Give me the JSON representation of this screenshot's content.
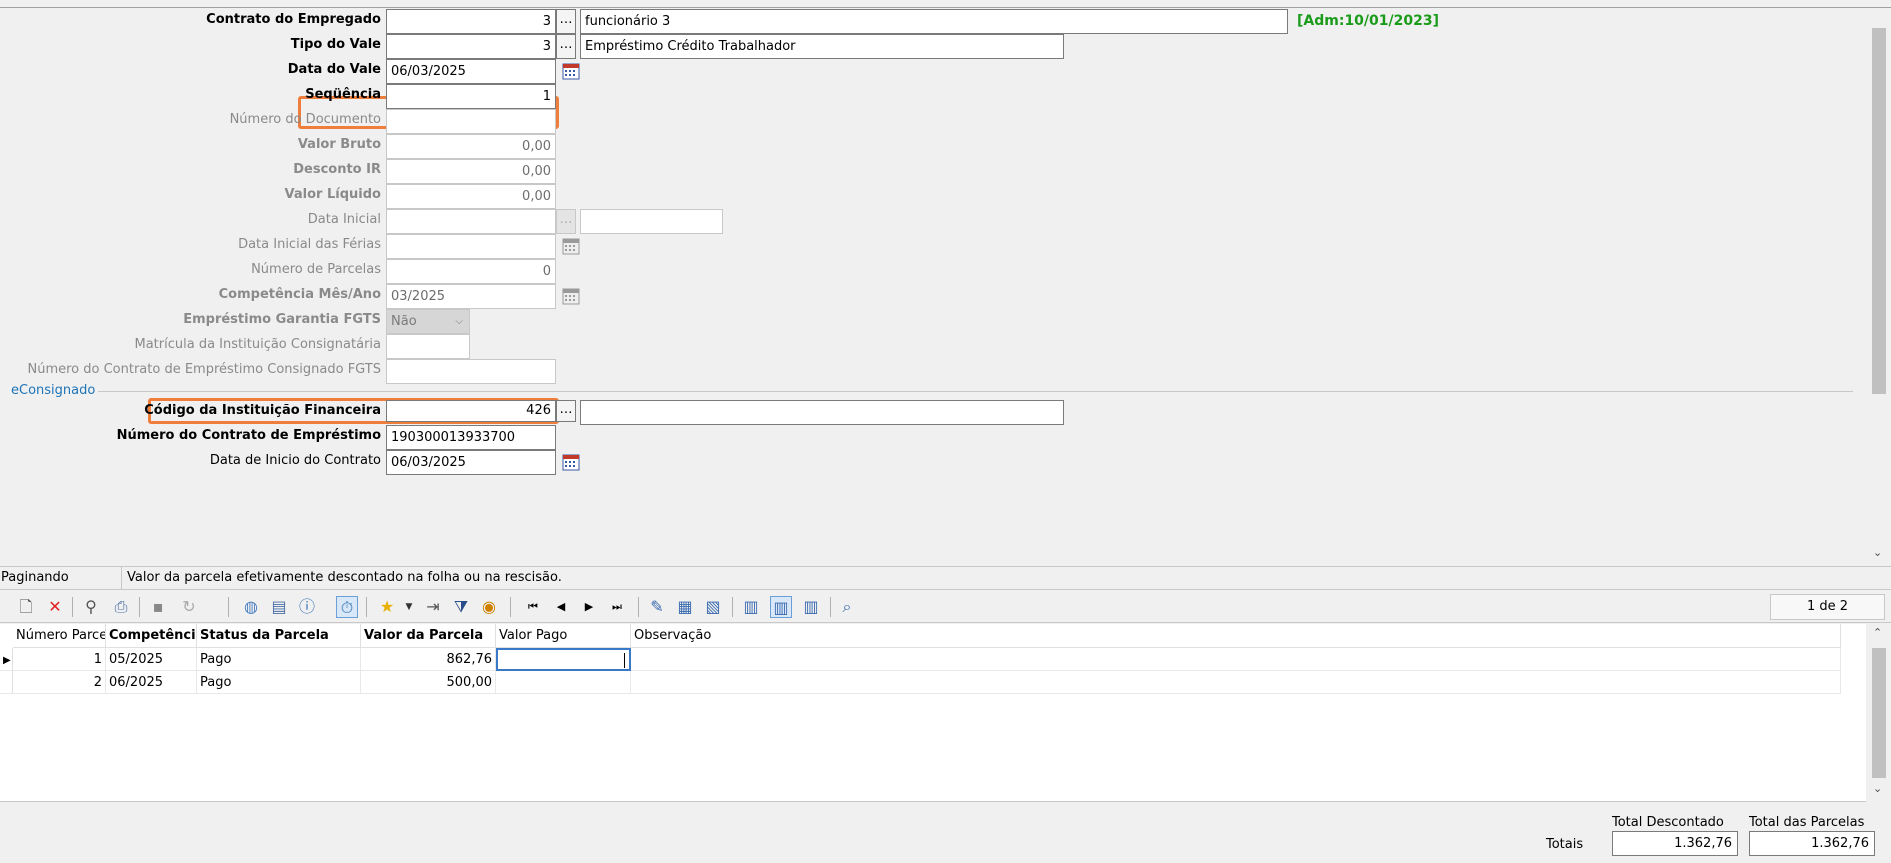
{
  "form": {
    "contrato": {
      "label": "Contrato do Empregado",
      "code": "3",
      "desc": "funcionário 3",
      "adm": "[Adm:10/01/2023]"
    },
    "tipo_vale": {
      "label": "Tipo do Vale",
      "code": "3",
      "desc": "Empréstimo Crédito Trabalhador"
    },
    "data_vale": {
      "label": "Data do Vale",
      "value": "06/03/2025"
    },
    "sequencia": {
      "label": "Seqüência",
      "value": "1"
    },
    "numero_documento": {
      "label": "Número do Documento",
      "value": ""
    },
    "valor_bruto": {
      "label": "Valor Bruto",
      "value": "0,00"
    },
    "desconto_ir": {
      "label": "Desconto IR",
      "value": "0,00"
    },
    "valor_liquido": {
      "label": "Valor Líquido",
      "value": "0,00"
    },
    "data_inicial": {
      "label": "Data Inicial",
      "value": "",
      "desc": ""
    },
    "data_inicial_ferias": {
      "label": "Data Inicial das Férias",
      "value": ""
    },
    "numero_parcelas": {
      "label": "Número de Parcelas",
      "value": "0"
    },
    "competencia": {
      "label": "Competência Mês/Ano",
      "value": "03/2025"
    },
    "garantia_fgts": {
      "label": "Empréstimo Garantia FGTS",
      "value": "Não"
    },
    "matricula_consignataria": {
      "label": "Matrícula da Instituição Consignatária",
      "value": ""
    },
    "numero_contrato_fgts": {
      "label": "Número do Contrato de Empréstimo Consignado FGTS",
      "value": ""
    },
    "section_econsignado": "eConsignado",
    "codigo_instituicao": {
      "label": "Código da Instituição Financeira",
      "value": "426",
      "desc": ""
    },
    "numero_contrato": {
      "label": "Número do Contrato de Empréstimo",
      "value": "190300013933700"
    },
    "data_inicio_contrato": {
      "label": "Data de Inicio do Contrato",
      "value": "06/03/2025"
    }
  },
  "status": {
    "mode": "Paginando",
    "hint": "Valor da parcela efetivamente descontado na folha ou na rescisão."
  },
  "toolbar": {
    "page_indicator": "1 de 2"
  },
  "grid": {
    "columns": [
      "Número Parcel",
      "Competênci",
      "Status da Parcela",
      "Valor da Parcela",
      "Valor Pago",
      "Observação"
    ],
    "rows": [
      {
        "numero": "1",
        "competencia": "05/2025",
        "status": "Pago",
        "valor": "862,76",
        "pago": "",
        "obs": ""
      },
      {
        "numero": "2",
        "competencia": "06/2025",
        "status": "Pago",
        "valor": "500,00",
        "pago": "",
        "obs": ""
      }
    ]
  },
  "totals": {
    "label": "Totais",
    "total_descontado_label": "Total Descontado",
    "total_descontado": "1.362,76",
    "total_parcelas_label": "Total das Parcelas",
    "total_parcelas": "1.362,76"
  },
  "colors": {
    "highlight": "#ef7d3c",
    "adm_green": "#1a9b1a",
    "section_blue": "#1e74b8"
  }
}
